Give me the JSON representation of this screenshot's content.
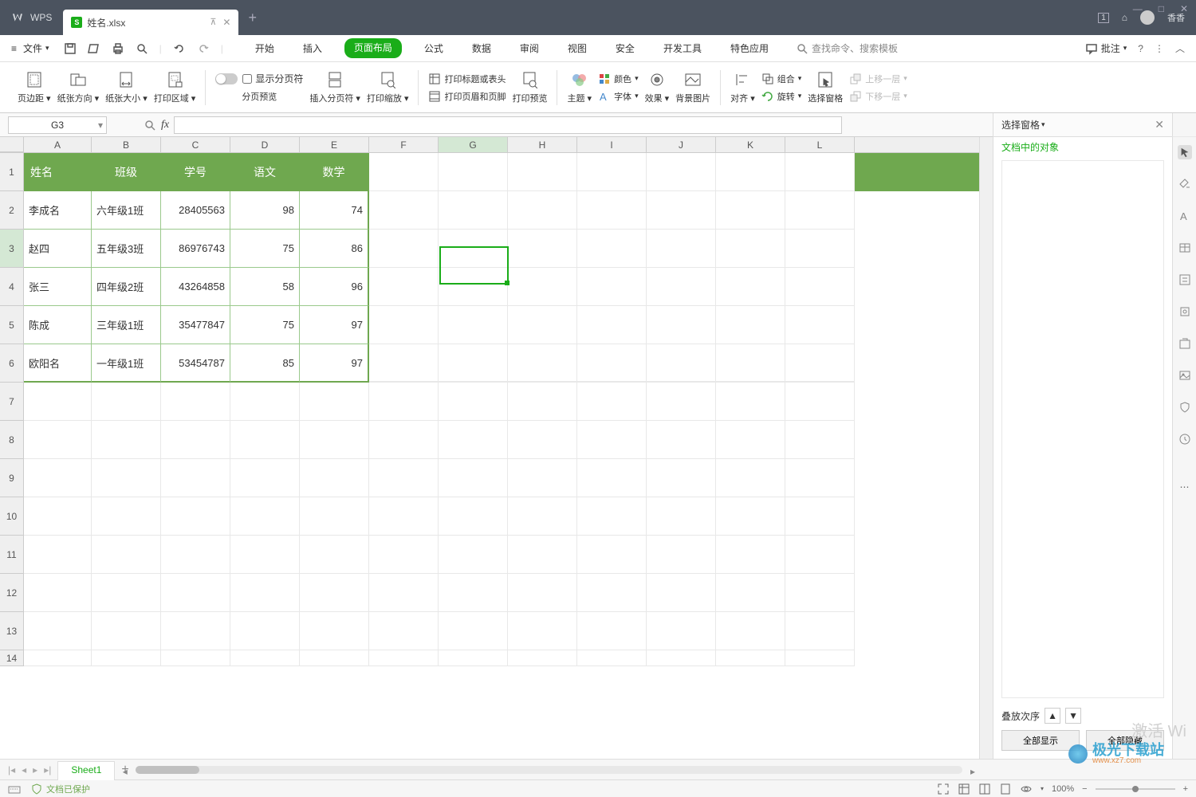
{
  "titlebar": {
    "app_name": "WPS",
    "tab_filename": "姓名.xlsx",
    "user_name": "香香"
  },
  "menubar": {
    "file_label": "文件",
    "tabs": [
      "开始",
      "插入",
      "页面布局",
      "公式",
      "数据",
      "审阅",
      "视图",
      "安全",
      "开发工具",
      "特色应用"
    ],
    "active_tab_index": 2,
    "search_placeholder": "查找命令、搜索模板",
    "comment_label": "批注"
  },
  "ribbon": {
    "margins": "页边距",
    "orientation": "纸张方向",
    "size": "纸张大小",
    "print_area": "打印区域",
    "show_page_break": "显示分页符",
    "page_break_preview": "分页预览",
    "insert_page_break": "插入分页符",
    "print_scale": "打印缩放",
    "print_titles": "打印标题或表头",
    "print_header_footer": "打印页眉和页脚",
    "print_preview": "打印预览",
    "theme": "主题",
    "colors": "颜色",
    "fonts": "字体",
    "effects": "效果",
    "bg_image": "背景图片",
    "align": "对齐",
    "group": "组合",
    "rotate": "旋转",
    "selection_pane": "选择窗格",
    "bring_forward": "上移一层",
    "send_backward": "下移一层"
  },
  "formula_bar": {
    "cell_ref": "G3"
  },
  "columns": [
    "A",
    "B",
    "C",
    "D",
    "E",
    "F",
    "G",
    "H",
    "I",
    "J",
    "K",
    "L"
  ],
  "active_column": "G",
  "row_numbers": [
    1,
    2,
    3,
    4,
    5,
    6,
    7,
    8,
    9,
    10,
    11,
    12,
    13,
    14
  ],
  "active_row": 3,
  "table": {
    "headers": [
      "姓名",
      "班级",
      "学号",
      "语文",
      "数学"
    ],
    "rows": [
      {
        "name": "李成名",
        "class": "六年级1班",
        "id": "28405563",
        "chinese": 98,
        "math": 74
      },
      {
        "name": "赵四",
        "class": "五年级3班",
        "id": "86976743",
        "chinese": 75,
        "math": 86
      },
      {
        "name": "张三",
        "class": "四年级2班",
        "id": "43264858",
        "chinese": 58,
        "math": 96
      },
      {
        "name": "陈成",
        "class": "三年级1班",
        "id": "35477847",
        "chinese": 75,
        "math": 97
      },
      {
        "name": "欧阳名",
        "class": "一年级1班",
        "id": "53454787",
        "chinese": 85,
        "math": 97
      }
    ]
  },
  "sheet_tabs": {
    "active": "Sheet1"
  },
  "statusbar": {
    "protect": "文档已保护",
    "zoom": "100%"
  },
  "selection_pane": {
    "title": "选择窗格",
    "doc_objects": "文档中的对象",
    "stack_order": "叠放次序",
    "show_all": "全部显示",
    "hide_all": "全部隐藏"
  },
  "watermark": {
    "activate": "激活 Wi",
    "logo_text": "极光下载站",
    "logo_url": "www.xz7.com"
  }
}
